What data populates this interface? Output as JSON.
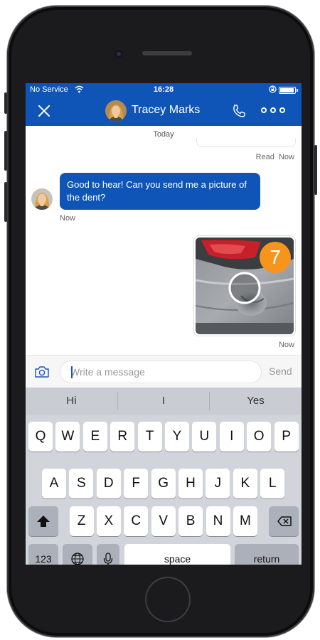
{
  "status_bar": {
    "carrier": "No Service",
    "time": "16:28"
  },
  "header": {
    "contact_name": "Tracey Marks"
  },
  "conversation": {
    "date_divider": "Today",
    "read_receipt": "Read  Now",
    "incoming_message": "Good to hear! Can you send me a picture of the dent?",
    "incoming_time": "Now",
    "photo_countdown": "7",
    "outgoing_time": "Now"
  },
  "composer": {
    "placeholder": "Write a message",
    "send_label": "Send"
  },
  "keyboard": {
    "predictions": [
      "Hi",
      "I",
      "Yes"
    ],
    "row1": [
      "Q",
      "W",
      "E",
      "R",
      "T",
      "Y",
      "U",
      "I",
      "O",
      "P"
    ],
    "row2": [
      "A",
      "S",
      "D",
      "F",
      "G",
      "H",
      "J",
      "K",
      "L"
    ],
    "row3": [
      "Z",
      "X",
      "C",
      "V",
      "B",
      "N",
      "M"
    ],
    "numbers_label": "123",
    "space_label": "space",
    "return_label": "return"
  },
  "colors": {
    "brand_blue": "#0f55b8",
    "badge_orange": "#f7941d",
    "keyboard_bg": "#d1d4da"
  },
  "icons": [
    "close-icon",
    "phone-icon",
    "more-icon",
    "camera-icon",
    "shift-icon",
    "backspace-icon",
    "globe-icon",
    "microphone-icon"
  ]
}
